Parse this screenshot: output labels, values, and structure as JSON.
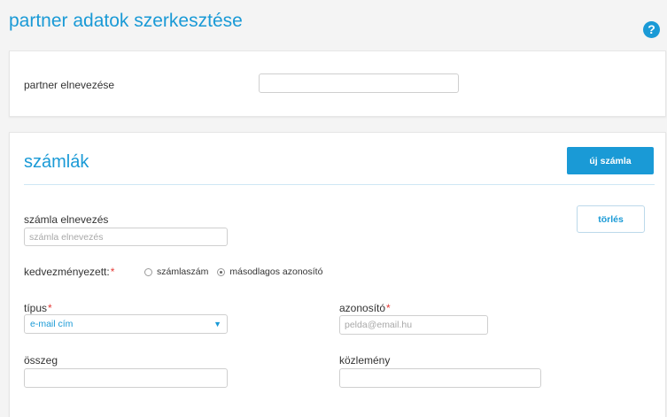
{
  "page": {
    "title": "partner adatok szerkesztése",
    "help_glyph": "?"
  },
  "partner": {
    "name_label": "partner elnevezése",
    "name_value": ""
  },
  "accounts": {
    "title": "számlák",
    "new_button": "új számla",
    "delete_button": "törlés",
    "account_name_label": "számla elnevezés",
    "account_name_placeholder": "számla elnevezés",
    "beneficiary_label": "kedvezményezett:",
    "beneficiary_options": [
      {
        "label": "számlaszám",
        "checked": false
      },
      {
        "label": "másodlagos azonosító",
        "checked": true
      }
    ],
    "type_label": "típus",
    "type_value": "e-mail cím",
    "identifier_label": "azonosító",
    "identifier_placeholder": "pelda@email.hu",
    "amount_label": "összeg",
    "memo_label": "közlemény"
  },
  "colors": {
    "accent": "#1a9ad6",
    "required": "#e53935"
  },
  "icons": {
    "help": "question-circle-icon",
    "dropdown": "chevron-down-icon"
  }
}
